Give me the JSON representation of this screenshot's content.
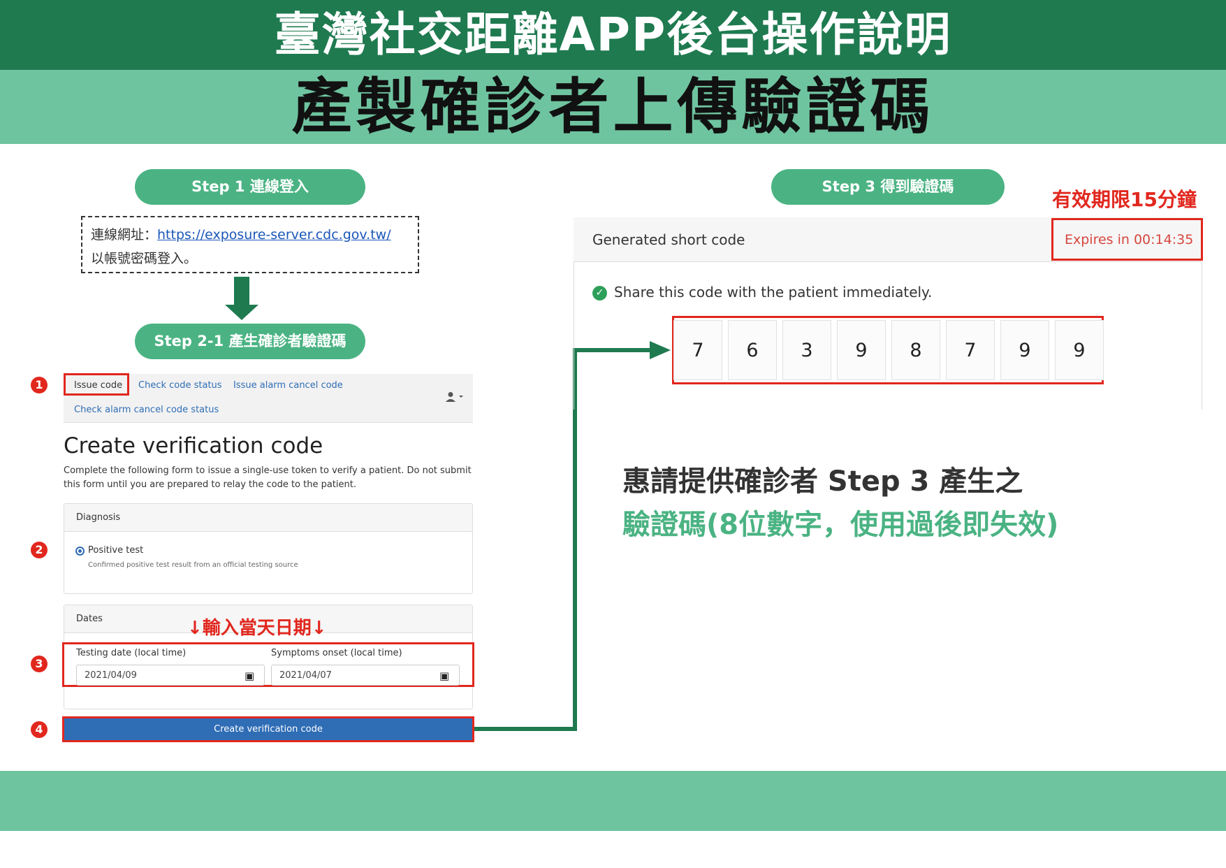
{
  "header": {
    "title": "臺灣社交距離APP後台操作說明",
    "subtitle": "產製確診者上傳驗證碼"
  },
  "step1": {
    "label": "Step 1 連線登入",
    "url_prefix": "連線網址：",
    "url": "https://exposure-server.cdc.gov.tw/",
    "login_text": "以帳號密碼登入。"
  },
  "step2": {
    "label": "Step 2-1 產生確診者驗證碼"
  },
  "step3": {
    "label": "Step 3 得到驗證碼",
    "validity_note": "有效期限15分鐘"
  },
  "markers": [
    "1",
    "2",
    "3",
    "4"
  ],
  "nav": {
    "items": [
      {
        "label": "Issue code"
      },
      {
        "label": "Check code status"
      },
      {
        "label": "Issue alarm cancel code"
      },
      {
        "label": "Check alarm cancel code status"
      }
    ],
    "user_icon": "user-icon"
  },
  "form": {
    "title": "Create verification code",
    "description": "Complete the following form to issue a single-use token to verify a patient. Do not submit this form until you are prepared to relay the code to the patient.",
    "diagnosis": {
      "header": "Diagnosis",
      "option_label": "Positive test",
      "option_help": "Confirmed positive test result from an official testing source"
    },
    "dates": {
      "header": "Dates",
      "note": "↓輸入當天日期↓",
      "testing_label": "Testing date (local time)",
      "testing_value": "2021/04/09",
      "symptoms_label": "Symptoms onset (local time)",
      "symptoms_value": "2021/04/07"
    },
    "submit_label": "Create verification code"
  },
  "result": {
    "title": "Generated short code",
    "expires": "Expires in 00:14:35",
    "share_text": "Share this code with the patient immediately.",
    "digits": [
      "7",
      "6",
      "3",
      "9",
      "8",
      "7",
      "9",
      "9"
    ]
  },
  "instructions": {
    "line1": "惠請提供確診者 Step 3 產生之",
    "line2": "驗證碼(8位數字，使用過後即失效)"
  },
  "colors": {
    "dark_green": "#1f7a50",
    "light_green": "#6fc4a0",
    "pill_green": "#4bb383",
    "highlight_red": "#e1271e",
    "button_blue": "#2f6db5"
  }
}
